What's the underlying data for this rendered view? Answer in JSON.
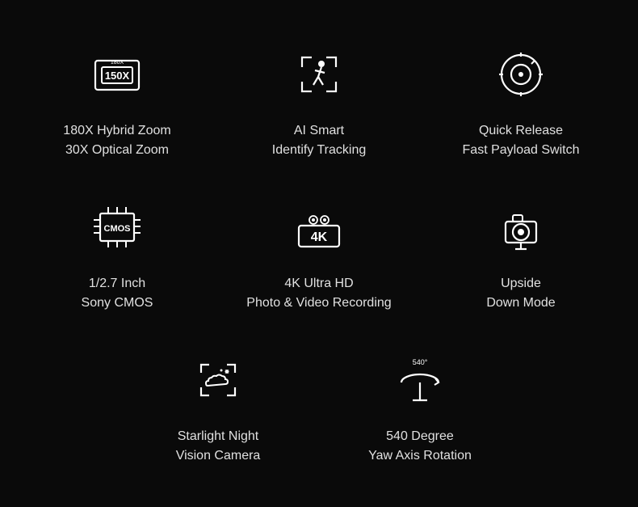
{
  "cells": [
    {
      "id": "hybrid-zoom",
      "icon": "zoom",
      "line1": "180X Hybrid Zoom",
      "line2": "30X Optical Zoom"
    },
    {
      "id": "ai-tracking",
      "icon": "tracking",
      "line1": "AI Smart",
      "line2": "Identify Tracking"
    },
    {
      "id": "quick-release",
      "icon": "release",
      "line1": "Quick Release",
      "line2": "Fast Payload Switch"
    },
    {
      "id": "sony-cmos",
      "icon": "cmos",
      "line1": "1/2.7 Inch",
      "line2": "Sony CMOS"
    },
    {
      "id": "4k-video",
      "icon": "4k",
      "line1": "4K Ultra HD",
      "line2": "Photo & Video Recording"
    },
    {
      "id": "upside-down",
      "icon": "upsidedown",
      "line1": "Upside",
      "line2": "Down Mode"
    },
    {
      "id": "starlight",
      "icon": "starlight",
      "line1": "Starlight Night",
      "line2": "Vision Camera"
    },
    {
      "id": "yaw-rotation",
      "icon": "yaw",
      "line1": "540 Degree",
      "line2": "Yaw Axis Rotation"
    }
  ]
}
